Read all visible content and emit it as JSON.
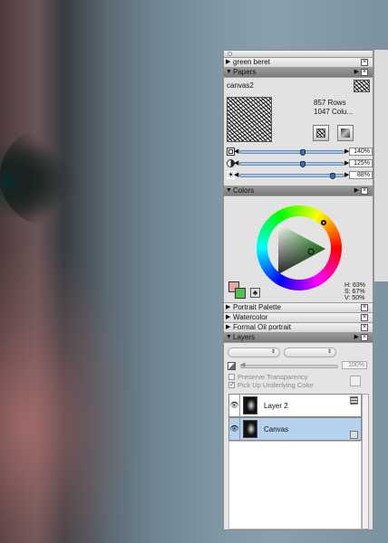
{
  "panel": {
    "green_beret": "green beret",
    "papers": {
      "title": "Papers",
      "paper_name": "canvas2",
      "rows": "857 Rows",
      "cols": "1047 Colu...",
      "sliders": [
        {
          "value": "140%",
          "level": 0.6
        },
        {
          "value": "125%",
          "level": 0.6
        },
        {
          "value": "88%",
          "level": 0.86
        }
      ]
    },
    "colors": {
      "title": "Colors",
      "h": "H: 63%",
      "s": "S: 67%",
      "v": "V: 50%",
      "primary": "#e8a6a6",
      "secondary": "#52c052"
    },
    "collapsed": [
      "Portrait Palette",
      "Watercolor",
      "Formal Oil portrait"
    ],
    "layers": {
      "title": "Layers",
      "opacity": "100%",
      "preserve": "Preserve Transparency",
      "pickup": "Pick Up Underlying Color",
      "items": [
        {
          "name": "Layer 2"
        },
        {
          "name": "Canvas"
        }
      ]
    }
  }
}
